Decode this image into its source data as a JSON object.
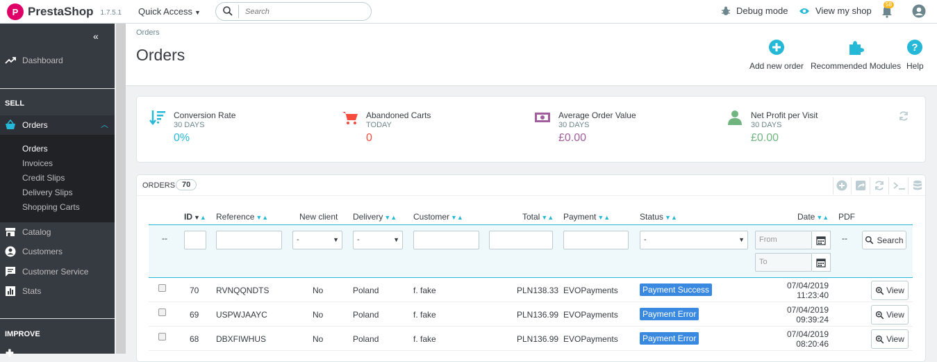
{
  "topbar": {
    "brand": "PrestaShop",
    "version": "1.7.5.1",
    "quick_access": "Quick Access",
    "search_placeholder": "Search",
    "debug_mode": "Debug mode",
    "view_shop": "View my shop",
    "notifications_count": "58"
  },
  "sidebar": {
    "dashboard": "Dashboard",
    "sell_heading": "SELL",
    "orders": "Orders",
    "sub": [
      "Orders",
      "Invoices",
      "Credit Slips",
      "Delivery Slips",
      "Shopping Carts"
    ],
    "catalog": "Catalog",
    "customers": "Customers",
    "customer_service": "Customer Service",
    "stats": "Stats",
    "improve_heading": "IMPROVE"
  },
  "header": {
    "breadcrumb": "Orders",
    "title": "Orders",
    "add_new_order": "Add new order",
    "recommended_modules": "Recommended Modules",
    "help": "Help"
  },
  "kpis": [
    {
      "title": "Conversion Rate",
      "period": "30 DAYS",
      "value": "0%",
      "color": "#25b9d7"
    },
    {
      "title": "Abandoned Carts",
      "period": "TODAY",
      "value": "0",
      "color": "#f54c3e"
    },
    {
      "title": "Average Order Value",
      "period": "30 DAYS",
      "value": "£0.00",
      "color": "#a05e9c"
    },
    {
      "title": "Net Profit per Visit",
      "period": "30 DAYS",
      "value": "£0.00",
      "color": "#70b580"
    }
  ],
  "panel": {
    "title": "ORDERS",
    "count": "70",
    "columns": [
      "ID",
      "Reference",
      "New client",
      "Delivery",
      "Customer",
      "Total",
      "Payment",
      "Status",
      "Date",
      "PDF"
    ],
    "filter": {
      "id_dash": "--",
      "select_dash": "-",
      "from_placeholder": "From",
      "to_placeholder": "To",
      "pdf_dash": "--",
      "search_label": "Search"
    },
    "rows": [
      {
        "id": "70",
        "reference": "RVNQQNDTS",
        "new_client": "No",
        "delivery": "Poland",
        "customer": "f. fake",
        "total": "PLN138.33",
        "payment": "EVOPayments",
        "status": "Payment Success",
        "date": "07/04/2019",
        "time": "11:23:40",
        "action": "View"
      },
      {
        "id": "69",
        "reference": "USPWJAAYC",
        "new_client": "No",
        "delivery": "Poland",
        "customer": "f. fake",
        "total": "PLN136.99",
        "payment": "EVOPayments",
        "status": "Payment Error",
        "date": "07/04/2019",
        "time": "09:39:24",
        "action": "View"
      },
      {
        "id": "68",
        "reference": "DBXFIWHUS",
        "new_client": "No",
        "delivery": "Poland",
        "customer": "f. fake",
        "total": "PLN136.99",
        "payment": "EVOPayments",
        "status": "Payment Error",
        "date": "07/04/2019",
        "time": "08:20:46",
        "action": "View"
      }
    ]
  }
}
